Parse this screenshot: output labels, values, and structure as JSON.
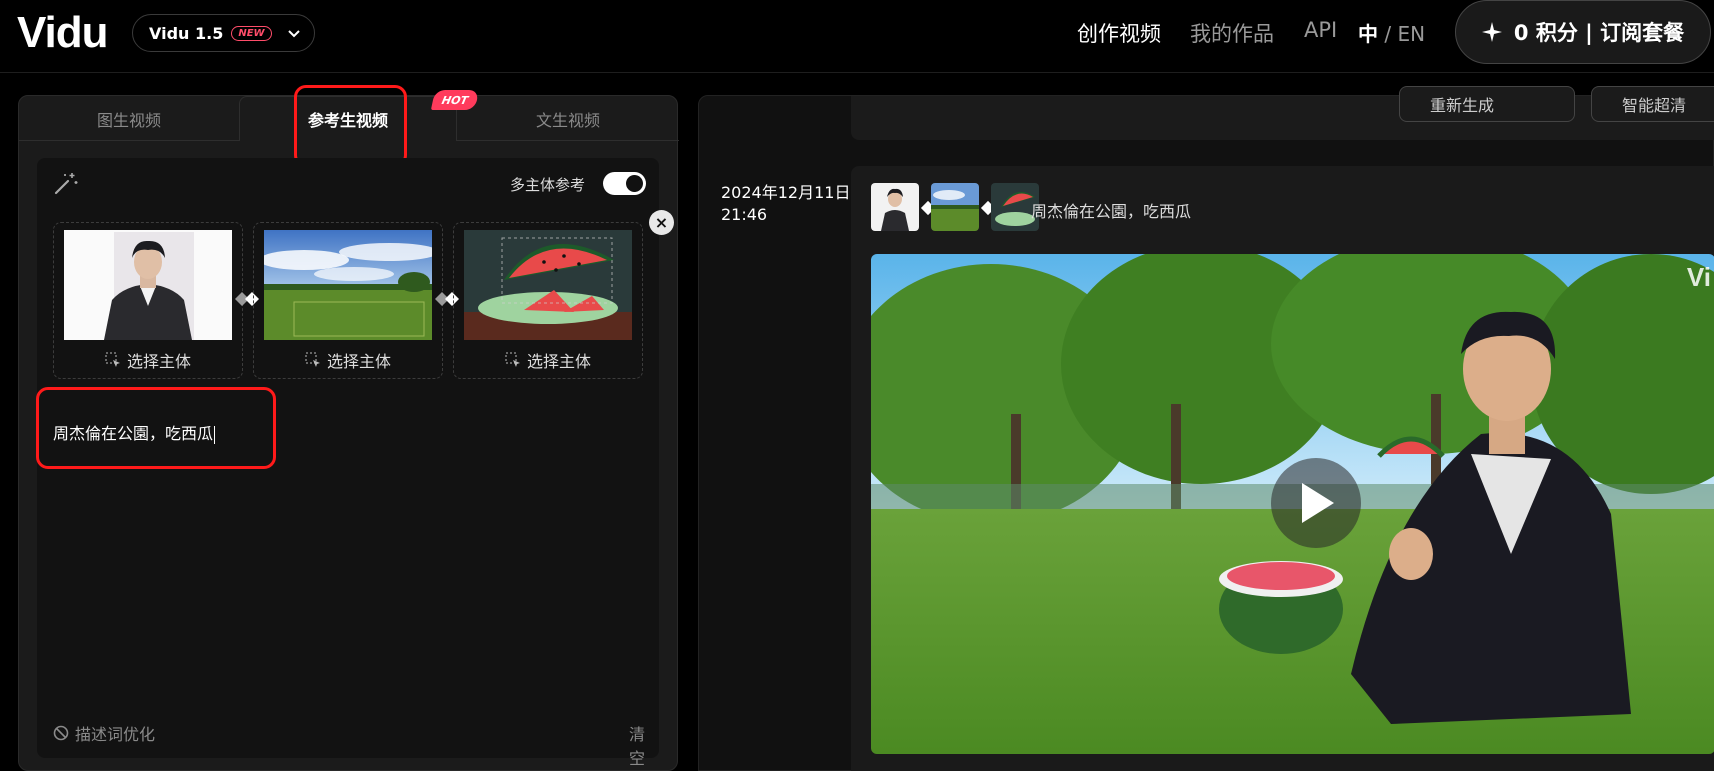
{
  "header": {
    "logo": "Vidu",
    "model": "Vidu 1.5",
    "model_badge": "NEW",
    "nav": [
      "创作视频",
      "我的作品",
      "API"
    ],
    "lang_zh": "中",
    "lang_sep": "/",
    "lang_en": "EN",
    "credits_label": "0 积分 | 订阅套餐"
  },
  "tabs": {
    "items": [
      "图生视频",
      "参考生视频",
      "文生视频"
    ],
    "active": "参考生视频",
    "hot_badge": "HOT"
  },
  "editor": {
    "multi_subject_label": "多主体参考",
    "multi_subject_enabled": true,
    "refs": [
      {
        "select_label": "选择主体",
        "icon": "person-photo"
      },
      {
        "select_label": "选择主体",
        "icon": "park-lawn-photo"
      },
      {
        "select_label": "选择主体",
        "icon": "watermelon-photo"
      }
    ],
    "prompt": "周杰倫在公園，吃西瓜",
    "optimize_label": "描述词优化",
    "clear_label": "清空"
  },
  "result": {
    "top_buttons": [
      "重新生成",
      "智能超清"
    ],
    "date": "2024年12月11日",
    "time": "21:46",
    "prompt": "周杰倫在公園，吃西瓜",
    "watermark": "Vi"
  },
  "colors": {
    "accent_red": "#ff1a1a",
    "badge_pink": "#ff4d6a",
    "background": "#000000"
  }
}
